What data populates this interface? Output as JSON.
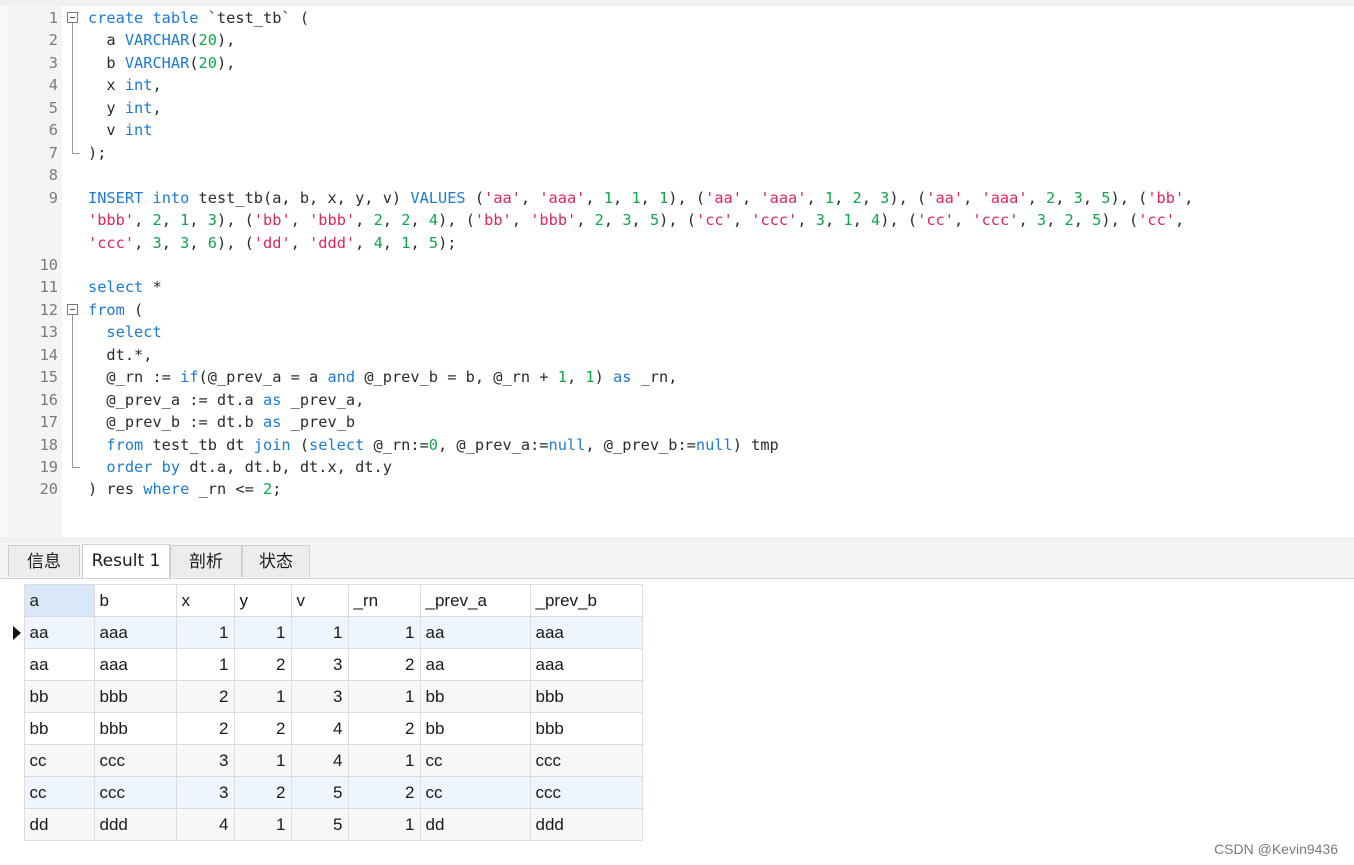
{
  "editor": {
    "lines": [
      {
        "n": "1",
        "segments": [
          [
            "kw",
            "create table"
          ],
          [
            "t",
            " `test_tb` ("
          ]
        ]
      },
      {
        "n": "2",
        "segments": [
          [
            "t",
            "  a "
          ],
          [
            "kw",
            "VARCHAR"
          ],
          [
            "t",
            "("
          ],
          [
            "num",
            "20"
          ],
          [
            "t",
            "),"
          ]
        ]
      },
      {
        "n": "3",
        "segments": [
          [
            "t",
            "  b "
          ],
          [
            "kw",
            "VARCHAR"
          ],
          [
            "t",
            "("
          ],
          [
            "num",
            "20"
          ],
          [
            "t",
            "),"
          ]
        ]
      },
      {
        "n": "4",
        "segments": [
          [
            "t",
            "  x "
          ],
          [
            "kw",
            "int"
          ],
          [
            "t",
            ","
          ]
        ]
      },
      {
        "n": "5",
        "segments": [
          [
            "t",
            "  y "
          ],
          [
            "kw",
            "int"
          ],
          [
            "t",
            ","
          ]
        ]
      },
      {
        "n": "6",
        "segments": [
          [
            "t",
            "  v "
          ],
          [
            "kw",
            "int"
          ]
        ]
      },
      {
        "n": "7",
        "segments": [
          [
            "t",
            ");"
          ]
        ]
      },
      {
        "n": "8",
        "segments": []
      },
      {
        "n": "9",
        "segments": [
          [
            "kw",
            "INSERT"
          ],
          [
            "t",
            " "
          ],
          [
            "kw",
            "into"
          ],
          [
            "t",
            " test_tb(a, b, x, y, v) "
          ],
          [
            "kw",
            "VALUES"
          ],
          [
            "t",
            " ("
          ],
          [
            "str",
            "'aa'"
          ],
          [
            "t",
            ", "
          ],
          [
            "str",
            "'aaa'"
          ],
          [
            "t",
            ", "
          ],
          [
            "num",
            "1"
          ],
          [
            "t",
            ", "
          ],
          [
            "num",
            "1"
          ],
          [
            "t",
            ", "
          ],
          [
            "num",
            "1"
          ],
          [
            "t",
            "), ("
          ],
          [
            "str",
            "'aa'"
          ],
          [
            "t",
            ", "
          ],
          [
            "str",
            "'aaa'"
          ],
          [
            "t",
            ", "
          ],
          [
            "num",
            "1"
          ],
          [
            "t",
            ", "
          ],
          [
            "num",
            "2"
          ],
          [
            "t",
            ", "
          ],
          [
            "num",
            "3"
          ],
          [
            "t",
            "), ("
          ],
          [
            "str",
            "'aa'"
          ],
          [
            "t",
            ", "
          ],
          [
            "str",
            "'aaa'"
          ],
          [
            "t",
            ", "
          ],
          [
            "num",
            "2"
          ],
          [
            "t",
            ", "
          ],
          [
            "num",
            "3"
          ],
          [
            "t",
            ", "
          ],
          [
            "num",
            "5"
          ],
          [
            "t",
            "), ("
          ],
          [
            "str",
            "'bb'"
          ],
          [
            "t",
            ","
          ]
        ]
      },
      {
        "n": "",
        "segments": [
          [
            "str",
            "'bbb'"
          ],
          [
            "t",
            ", "
          ],
          [
            "num",
            "2"
          ],
          [
            "t",
            ", "
          ],
          [
            "num",
            "1"
          ],
          [
            "t",
            ", "
          ],
          [
            "num",
            "3"
          ],
          [
            "t",
            "), ("
          ],
          [
            "str",
            "'bb'"
          ],
          [
            "t",
            ", "
          ],
          [
            "str",
            "'bbb'"
          ],
          [
            "t",
            ", "
          ],
          [
            "num",
            "2"
          ],
          [
            "t",
            ", "
          ],
          [
            "num",
            "2"
          ],
          [
            "t",
            ", "
          ],
          [
            "num",
            "4"
          ],
          [
            "t",
            "), ("
          ],
          [
            "str",
            "'bb'"
          ],
          [
            "t",
            ", "
          ],
          [
            "str",
            "'bbb'"
          ],
          [
            "t",
            ", "
          ],
          [
            "num",
            "2"
          ],
          [
            "t",
            ", "
          ],
          [
            "num",
            "3"
          ],
          [
            "t",
            ", "
          ],
          [
            "num",
            "5"
          ],
          [
            "t",
            "), ("
          ],
          [
            "str",
            "'cc'"
          ],
          [
            "t",
            ", "
          ],
          [
            "str",
            "'ccc'"
          ],
          [
            "t",
            ", "
          ],
          [
            "num",
            "3"
          ],
          [
            "t",
            ", "
          ],
          [
            "num",
            "1"
          ],
          [
            "t",
            ", "
          ],
          [
            "num",
            "4"
          ],
          [
            "t",
            "), ("
          ],
          [
            "str",
            "'cc'"
          ],
          [
            "t",
            ", "
          ],
          [
            "str",
            "'ccc'"
          ],
          [
            "t",
            ", "
          ],
          [
            "num",
            "3"
          ],
          [
            "t",
            ", "
          ],
          [
            "num",
            "2"
          ],
          [
            "t",
            ", "
          ],
          [
            "num",
            "5"
          ],
          [
            "t",
            "), ("
          ],
          [
            "str",
            "'cc'"
          ],
          [
            "t",
            ","
          ]
        ]
      },
      {
        "n": "",
        "segments": [
          [
            "str",
            "'ccc'"
          ],
          [
            "t",
            ", "
          ],
          [
            "num",
            "3"
          ],
          [
            "t",
            ", "
          ],
          [
            "num",
            "3"
          ],
          [
            "t",
            ", "
          ],
          [
            "num",
            "6"
          ],
          [
            "t",
            "), ("
          ],
          [
            "str",
            "'dd'"
          ],
          [
            "t",
            ", "
          ],
          [
            "str",
            "'ddd'"
          ],
          [
            "t",
            ", "
          ],
          [
            "num",
            "4"
          ],
          [
            "t",
            ", "
          ],
          [
            "num",
            "1"
          ],
          [
            "t",
            ", "
          ],
          [
            "num",
            "5"
          ],
          [
            "t",
            ");"
          ]
        ]
      },
      {
        "n": "10",
        "segments": []
      },
      {
        "n": "11",
        "segments": [
          [
            "kw",
            "select"
          ],
          [
            "t",
            " *"
          ]
        ]
      },
      {
        "n": "12",
        "segments": [
          [
            "kw",
            "from"
          ],
          [
            "t",
            " ("
          ]
        ]
      },
      {
        "n": "13",
        "segments": [
          [
            "t",
            "  "
          ],
          [
            "kw",
            "select"
          ]
        ]
      },
      {
        "n": "14",
        "segments": [
          [
            "t",
            "  dt.*,"
          ]
        ]
      },
      {
        "n": "15",
        "segments": [
          [
            "t",
            "  @_rn := "
          ],
          [
            "kw",
            "if"
          ],
          [
            "t",
            "(@_prev_a = a "
          ],
          [
            "kw",
            "and"
          ],
          [
            "t",
            " @_prev_b = b, @_rn + "
          ],
          [
            "num",
            "1"
          ],
          [
            "t",
            ", "
          ],
          [
            "num",
            "1"
          ],
          [
            "t",
            ") "
          ],
          [
            "kw",
            "as"
          ],
          [
            "t",
            " _rn,"
          ]
        ]
      },
      {
        "n": "16",
        "segments": [
          [
            "t",
            "  @_prev_a := dt.a "
          ],
          [
            "kw",
            "as"
          ],
          [
            "t",
            " _prev_a,"
          ]
        ]
      },
      {
        "n": "17",
        "segments": [
          [
            "t",
            "  @_prev_b := dt.b "
          ],
          [
            "kw",
            "as"
          ],
          [
            "t",
            " _prev_b"
          ]
        ]
      },
      {
        "n": "18",
        "segments": [
          [
            "t",
            "  "
          ],
          [
            "kw",
            "from"
          ],
          [
            "t",
            " test_tb dt "
          ],
          [
            "kw",
            "join"
          ],
          [
            "t",
            " ("
          ],
          [
            "kw",
            "select"
          ],
          [
            "t",
            " @_rn:="
          ],
          [
            "num",
            "0"
          ],
          [
            "t",
            ", @_prev_a:="
          ],
          [
            "kw",
            "null"
          ],
          [
            "t",
            ", @_prev_b:="
          ],
          [
            "kw",
            "null"
          ],
          [
            "t",
            ") tmp"
          ]
        ]
      },
      {
        "n": "19",
        "segments": [
          [
            "t",
            "  "
          ],
          [
            "kw",
            "order by"
          ],
          [
            "t",
            " dt.a, dt.b, dt.x, dt.y"
          ]
        ]
      },
      {
        "n": "20",
        "segments": [
          [
            "t",
            ") res "
          ],
          [
            "kw",
            "where"
          ],
          [
            "t",
            " _rn <= "
          ],
          [
            "num",
            "2"
          ],
          [
            "t",
            ";"
          ]
        ]
      }
    ]
  },
  "tabs": [
    {
      "label": "信息",
      "active": false
    },
    {
      "label": "Result 1",
      "active": true
    },
    {
      "label": "剖析",
      "active": false
    },
    {
      "label": "状态",
      "active": false
    }
  ],
  "grid": {
    "columns": [
      "a",
      "b",
      "x",
      "y",
      "v",
      "_rn",
      "_prev_a",
      "_prev_b"
    ],
    "rows": [
      [
        "aa",
        "aaa",
        "1",
        "1",
        "1",
        "1",
        "aa",
        "aaa"
      ],
      [
        "aa",
        "aaa",
        "1",
        "2",
        "3",
        "2",
        "aa",
        "aaa"
      ],
      [
        "bb",
        "bbb",
        "2",
        "1",
        "3",
        "1",
        "bb",
        "bbb"
      ],
      [
        "bb",
        "bbb",
        "2",
        "2",
        "4",
        "2",
        "bb",
        "bbb"
      ],
      [
        "cc",
        "ccc",
        "3",
        "1",
        "4",
        "1",
        "cc",
        "ccc"
      ],
      [
        "cc",
        "ccc",
        "3",
        "2",
        "5",
        "2",
        "cc",
        "ccc"
      ],
      [
        "dd",
        "ddd",
        "4",
        "1",
        "5",
        "1",
        "dd",
        "ddd"
      ]
    ]
  },
  "watermark": "CSDN @Kevin9436",
  "colors": {
    "keyword": "#1b7bd6",
    "number": "#10a64a",
    "string": "#e0245e",
    "line_number": "#7a7a7a"
  }
}
